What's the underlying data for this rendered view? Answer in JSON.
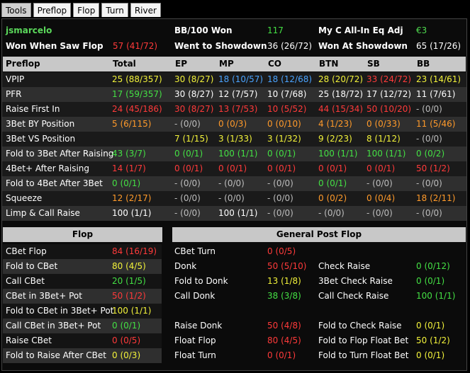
{
  "tabs": [
    "Tools",
    "Preflop",
    "Flop",
    "Turn",
    "River"
  ],
  "summary": {
    "player": "jsmarcelo",
    "bb100_label": "BB/100 Won",
    "bb100_value": "117",
    "allin_label": "My C All-In Eq Adj",
    "allin_value": "€3",
    "wwsf_label": "Won When Saw Flop",
    "wwsf_value": "57 (41/72)",
    "wtsd_label": "Went to Showdown",
    "wtsd_value": "36 (26/72)",
    "wsd_label": "Won At Showdown",
    "wsd_value": "65 (17/26)"
  },
  "preflop": {
    "headers": [
      "Preflop",
      "Total",
      "EP",
      "MP",
      "CO",
      "BTN",
      "SB",
      "BB"
    ],
    "rows": [
      {
        "label": "VPIP",
        "cells": [
          [
            "25 (88/357)",
            "yellow"
          ],
          [
            "30 (8/27)",
            "yellow"
          ],
          [
            "18 (10/57)",
            "blue"
          ],
          [
            "18 (12/68)",
            "blue"
          ],
          [
            "28 (20/72)",
            "yellow"
          ],
          [
            "33 (24/72)",
            "red"
          ],
          [
            "23 (14/61)",
            "yellow"
          ]
        ]
      },
      {
        "label": "PFR",
        "cells": [
          [
            "17 (59/357)",
            "green"
          ],
          [
            "30 (8/27)",
            "white"
          ],
          [
            "12 (7/57)",
            "white"
          ],
          [
            "10 (7/68)",
            "white"
          ],
          [
            "25 (18/72)",
            "white"
          ],
          [
            "17 (12/72)",
            "white"
          ],
          [
            "11 (7/61)",
            "white"
          ]
        ]
      },
      {
        "label": "Raise First In",
        "cells": [
          [
            "24 (45/186)",
            "red"
          ],
          [
            "30 (8/27)",
            "red"
          ],
          [
            "13 (7/53)",
            "red"
          ],
          [
            "10 (5/52)",
            "red"
          ],
          [
            "44 (15/34)",
            "red"
          ],
          [
            "50 (10/20)",
            "red"
          ],
          [
            "- (0/0)",
            "gray"
          ]
        ]
      },
      {
        "label": "3Bet BY Position",
        "cells": [
          [
            "5 (6/115)",
            "orange"
          ],
          [
            "- (0/0)",
            "gray"
          ],
          [
            "0 (0/3)",
            "orange"
          ],
          [
            "0 (0/10)",
            "orange"
          ],
          [
            "4 (1/23)",
            "orange"
          ],
          [
            "0 (0/33)",
            "orange"
          ],
          [
            "11 (5/46)",
            "orange"
          ]
        ]
      },
      {
        "label": "3Bet VS Position",
        "cells": [
          [
            "",
            "white"
          ],
          [
            "7 (1/15)",
            "yellow"
          ],
          [
            "3 (1/33)",
            "yellow"
          ],
          [
            "3 (1/32)",
            "yellow"
          ],
          [
            "9 (2/23)",
            "yellow"
          ],
          [
            "8 (1/12)",
            "yellow"
          ],
          [
            "- (0/0)",
            "gray"
          ]
        ]
      },
      {
        "label": "Fold to 3Bet After Raising",
        "cells": [
          [
            "43 (3/7)",
            "green"
          ],
          [
            "0 (0/1)",
            "green"
          ],
          [
            "100 (1/1)",
            "green"
          ],
          [
            "0 (0/1)",
            "green"
          ],
          [
            "100 (1/1)",
            "green"
          ],
          [
            "100 (1/1)",
            "green"
          ],
          [
            "0 (0/2)",
            "green"
          ]
        ]
      },
      {
        "label": "4Bet+ After Raising",
        "cells": [
          [
            "14 (1/7)",
            "red"
          ],
          [
            "0 (0/1)",
            "red"
          ],
          [
            "0 (0/1)",
            "red"
          ],
          [
            "0 (0/1)",
            "red"
          ],
          [
            "0 (0/1)",
            "red"
          ],
          [
            "0 (0/1)",
            "red"
          ],
          [
            "50 (1/2)",
            "red"
          ]
        ]
      },
      {
        "label": "Fold to 4Bet After 3Bet",
        "cells": [
          [
            "0 (0/1)",
            "green"
          ],
          [
            "- (0/0)",
            "gray"
          ],
          [
            "- (0/0)",
            "gray"
          ],
          [
            "- (0/0)",
            "gray"
          ],
          [
            "0 (0/1)",
            "green"
          ],
          [
            "- (0/0)",
            "gray"
          ],
          [
            "- (0/0)",
            "gray"
          ]
        ]
      },
      {
        "label": "Squeeze",
        "cells": [
          [
            "12 (2/17)",
            "orange"
          ],
          [
            "- (0/0)",
            "gray"
          ],
          [
            "- (0/0)",
            "gray"
          ],
          [
            "- (0/0)",
            "gray"
          ],
          [
            "0 (0/2)",
            "orange"
          ],
          [
            "0 (0/4)",
            "orange"
          ],
          [
            "18 (2/11)",
            "orange"
          ]
        ]
      },
      {
        "label": "Limp & Call Raise",
        "cells": [
          [
            "100 (1/1)",
            "white"
          ],
          [
            "- (0/0)",
            "gray"
          ],
          [
            "100 (1/1)",
            "white"
          ],
          [
            "- (0/0)",
            "gray"
          ],
          [
            "- (0/0)",
            "gray"
          ],
          [
            "- (0/0)",
            "gray"
          ],
          [
            "- (0/0)",
            "gray"
          ]
        ]
      }
    ]
  },
  "postflop": {
    "flop_header": "Flop",
    "general_header": "General Post Flop",
    "rows": [
      [
        [
          "CBet Flop",
          "84 (16/19)",
          "red"
        ],
        [
          "CBet Turn",
          "0 (0/5)",
          "red"
        ],
        [
          "",
          "",
          " white"
        ]
      ],
      [
        [
          "Fold to CBet",
          "80 (4/5)",
          "yellow"
        ],
        [
          "Donk",
          "50 (5/10)",
          "red"
        ],
        [
          "Check Raise",
          "0 (0/12)",
          "green"
        ]
      ],
      [
        [
          "Call CBet",
          "20 (1/5)",
          "green"
        ],
        [
          "Fold to Donk",
          "13 (1/8)",
          "yellow"
        ],
        [
          "3Bet Check Raise",
          "0 (0/1)",
          "green"
        ]
      ],
      [
        [
          "CBet in 3Bet+ Pot",
          "50 (1/2)",
          "red"
        ],
        [
          "Call Donk",
          "38 (3/8)",
          "green"
        ],
        [
          "Call Check Raise",
          "100 (1/1)",
          "green"
        ]
      ],
      [
        [
          "Fold to CBet in 3Bet+ Pot",
          "100 (1/1)",
          "yellow"
        ],
        [
          "",
          "",
          "white"
        ],
        [
          "",
          "",
          "white"
        ]
      ],
      [
        [
          "Call CBet in 3Bet+ Pot",
          "0 (0/1)",
          "green"
        ],
        [
          "Raise Donk",
          "50 (4/8)",
          "red"
        ],
        [
          "Fold to Check Raise",
          "0 (0/1)",
          "yellow"
        ]
      ],
      [
        [
          "Raise CBet",
          "0 (0/5)",
          "red"
        ],
        [
          "Float Flop",
          "80 (4/5)",
          "red"
        ],
        [
          "Fold to Flop Float Bet",
          "50 (1/2)",
          "yellow"
        ]
      ],
      [
        [
          "Fold to Raise After CBet",
          "0 (0/3)",
          "yellow"
        ],
        [
          "Float Turn",
          "0 (0/1)",
          "red"
        ],
        [
          "Fold to Turn Float Bet",
          "0 (0/1)",
          "yellow"
        ]
      ]
    ]
  },
  "colors": {
    "red": "#ff3a3a",
    "yellow": "#f2f23a",
    "green": "#44e044",
    "blue": "#4aa3ff",
    "orange": "#ff9a2a",
    "white": "#ffffff",
    "gray": "#bdbdbd",
    "euro": "#4fdc4f"
  }
}
